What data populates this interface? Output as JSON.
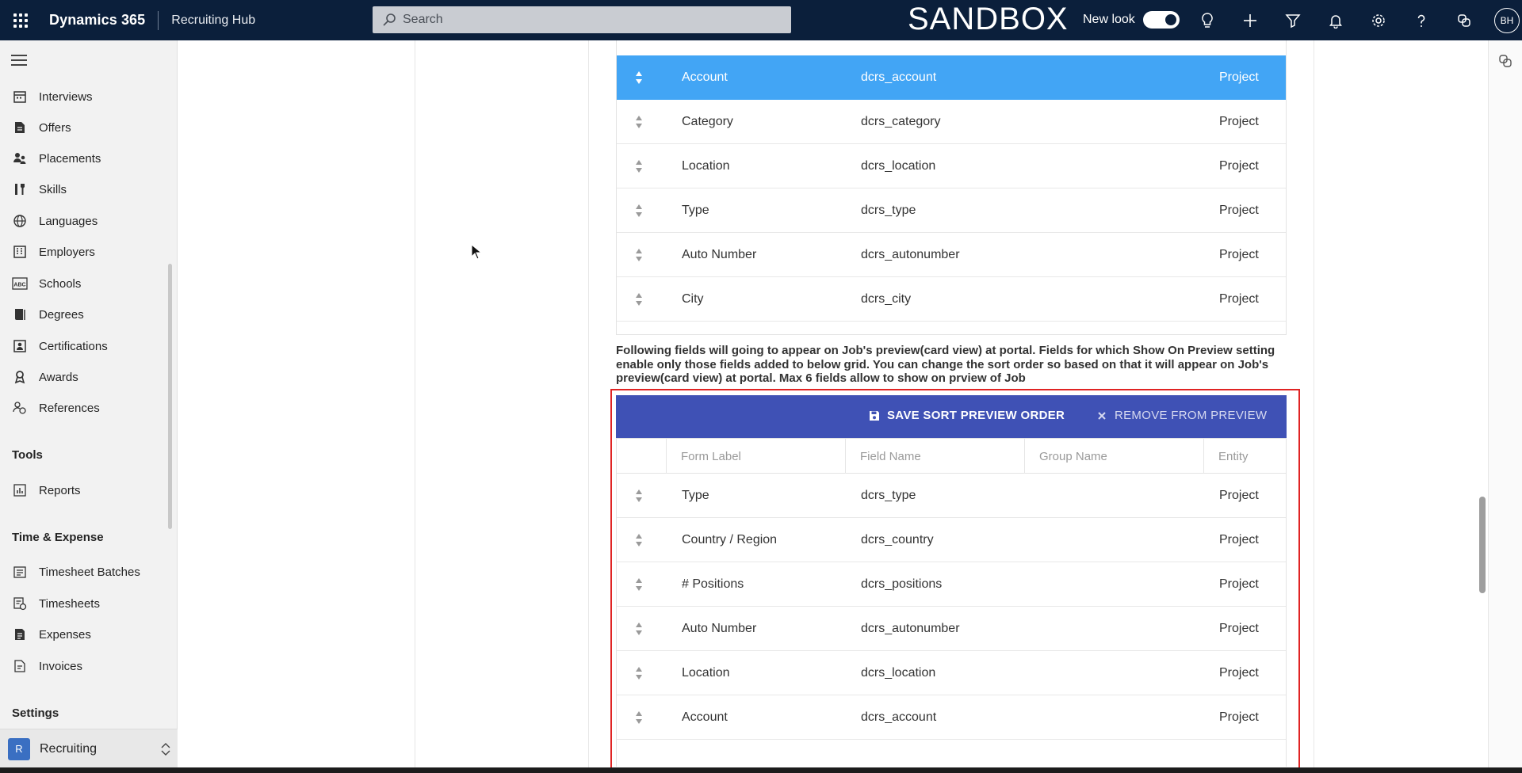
{
  "topbar": {
    "brand": "Dynamics 365",
    "app_name": "Recruiting Hub",
    "search_placeholder": "Search",
    "environment": "SANDBOX",
    "new_look_label": "New look",
    "avatar_initials": "BH"
  },
  "sidebar": {
    "items": [
      {
        "label": "Interviews",
        "icon": "calendar-icon"
      },
      {
        "label": "Offers",
        "icon": "document-icon"
      },
      {
        "label": "Placements",
        "icon": "people-icon"
      },
      {
        "label": "Skills",
        "icon": "tools-icon"
      },
      {
        "label": "Languages",
        "icon": "globe-icon"
      },
      {
        "label": "Employers",
        "icon": "building-icon"
      },
      {
        "label": "Schools",
        "icon": "abc-icon"
      },
      {
        "label": "Degrees",
        "icon": "book-icon"
      },
      {
        "label": "Certifications",
        "icon": "certificate-icon"
      },
      {
        "label": "Awards",
        "icon": "award-icon"
      },
      {
        "label": "References",
        "icon": "reference-icon"
      }
    ],
    "group_tools": "Tools",
    "tools_items": [
      {
        "label": "Reports",
        "icon": "report-icon"
      }
    ],
    "group_time": "Time & Expense",
    "time_items": [
      {
        "label": "Timesheet Batches",
        "icon": "batch-icon"
      },
      {
        "label": "Timesheets",
        "icon": "timesheet-icon"
      },
      {
        "label": "Expenses",
        "icon": "expense-icon"
      },
      {
        "label": "Invoices",
        "icon": "invoice-icon"
      }
    ],
    "group_settings": "Settings",
    "area": {
      "badge": "R",
      "label": "Recruiting"
    }
  },
  "grid_top": {
    "rows": [
      {
        "label": "Account",
        "field": "dcrs_account",
        "entity": "Project",
        "selected": true
      },
      {
        "label": "Category",
        "field": "dcrs_category",
        "entity": "Project",
        "selected": false
      },
      {
        "label": "Location",
        "field": "dcrs_location",
        "entity": "Project",
        "selected": false
      },
      {
        "label": "Type",
        "field": "dcrs_type",
        "entity": "Project",
        "selected": false
      },
      {
        "label": "Auto Number",
        "field": "dcrs_autonumber",
        "entity": "Project",
        "selected": false
      },
      {
        "label": "City",
        "field": "dcrs_city",
        "entity": "Project",
        "selected": false
      }
    ]
  },
  "info": {
    "line1": "Following fields will going to appear on Job's preview(card view) at portal. Fields for which Show On Preview setting",
    "line2": "enable only those fields added to below grid. You can change the sort order so based on that it will appear on Job's",
    "line3": "preview(card view) at portal. Max 6 fields allow to show on prview of Job"
  },
  "preview_grid": {
    "save_label": "SAVE SORT PREVIEW ORDER",
    "remove_label": "REMOVE FROM PREVIEW",
    "headers": {
      "form_label": "Form Label",
      "field_name": "Field Name",
      "group_name": "Group Name",
      "entity": "Entity"
    },
    "rows": [
      {
        "label": "Type",
        "field": "dcrs_type",
        "entity": "Project"
      },
      {
        "label": "Country / Region",
        "field": "dcrs_country",
        "entity": "Project"
      },
      {
        "label": "# Positions",
        "field": "dcrs_positions",
        "entity": "Project"
      },
      {
        "label": "Auto Number",
        "field": "dcrs_autonumber",
        "entity": "Project"
      },
      {
        "label": "Location",
        "field": "dcrs_location",
        "entity": "Project"
      },
      {
        "label": "Account",
        "field": "dcrs_account",
        "entity": "Project"
      }
    ]
  },
  "colors": {
    "topbar": "#0b1f3b",
    "selected_row": "#42a5f5",
    "toolbar": "#3f51b5",
    "highlight": "#e02424"
  }
}
